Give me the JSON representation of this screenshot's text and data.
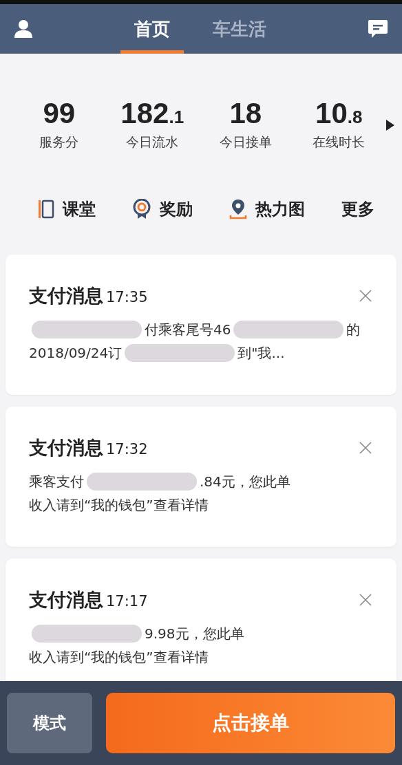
{
  "header": {
    "tabs": [
      {
        "label": "首页",
        "selected": true
      },
      {
        "label": "车生活",
        "selected": false
      }
    ]
  },
  "stats": [
    {
      "value": "99",
      "label": "服务分"
    },
    {
      "value": "182",
      "decimal": ".1",
      "label": "今日流水"
    },
    {
      "value": "18",
      "label": "今日接单"
    },
    {
      "value": "10",
      "decimal": ".8",
      "label": "在线时长"
    }
  ],
  "shortcuts": [
    {
      "label": "课堂",
      "kind": "book"
    },
    {
      "label": "奖励",
      "kind": "medal"
    },
    {
      "label": "热力图",
      "kind": "pin"
    },
    {
      "label": "更多",
      "kind": "none"
    }
  ],
  "messages": [
    {
      "title": "支付消息",
      "time": "17:35",
      "lines": [
        [
          {
            "kind": "blur"
          },
          {
            "kind": "text",
            "text": "付乘客尾号46"
          },
          {
            "kind": "blur"
          },
          {
            "kind": "text",
            "text": "的"
          }
        ],
        [
          {
            "kind": "text",
            "text": "2018/09/24订"
          },
          {
            "kind": "blur"
          },
          {
            "kind": "text",
            "text": "到\"我..."
          }
        ]
      ]
    },
    {
      "title": "支付消息",
      "time": "17:32",
      "lines": [
        [
          {
            "kind": "text",
            "text": "乘客支付"
          },
          {
            "kind": "blur"
          },
          {
            "kind": "text",
            "text": ".84元，您此单"
          }
        ],
        [
          {
            "kind": "text",
            "text": "收入请到“我的钱包”查看详情"
          }
        ]
      ]
    },
    {
      "title": "支付消息",
      "time": "17:17",
      "lines": [
        [
          {
            "kind": "blur"
          },
          {
            "kind": "text",
            "text": "9.98元，您此单"
          }
        ],
        [
          {
            "kind": "text",
            "text": "收入请到“我的钱包”查看详情"
          }
        ]
      ]
    }
  ],
  "bottom": {
    "mode_button": "模式",
    "accept_button": "点击接单"
  }
}
